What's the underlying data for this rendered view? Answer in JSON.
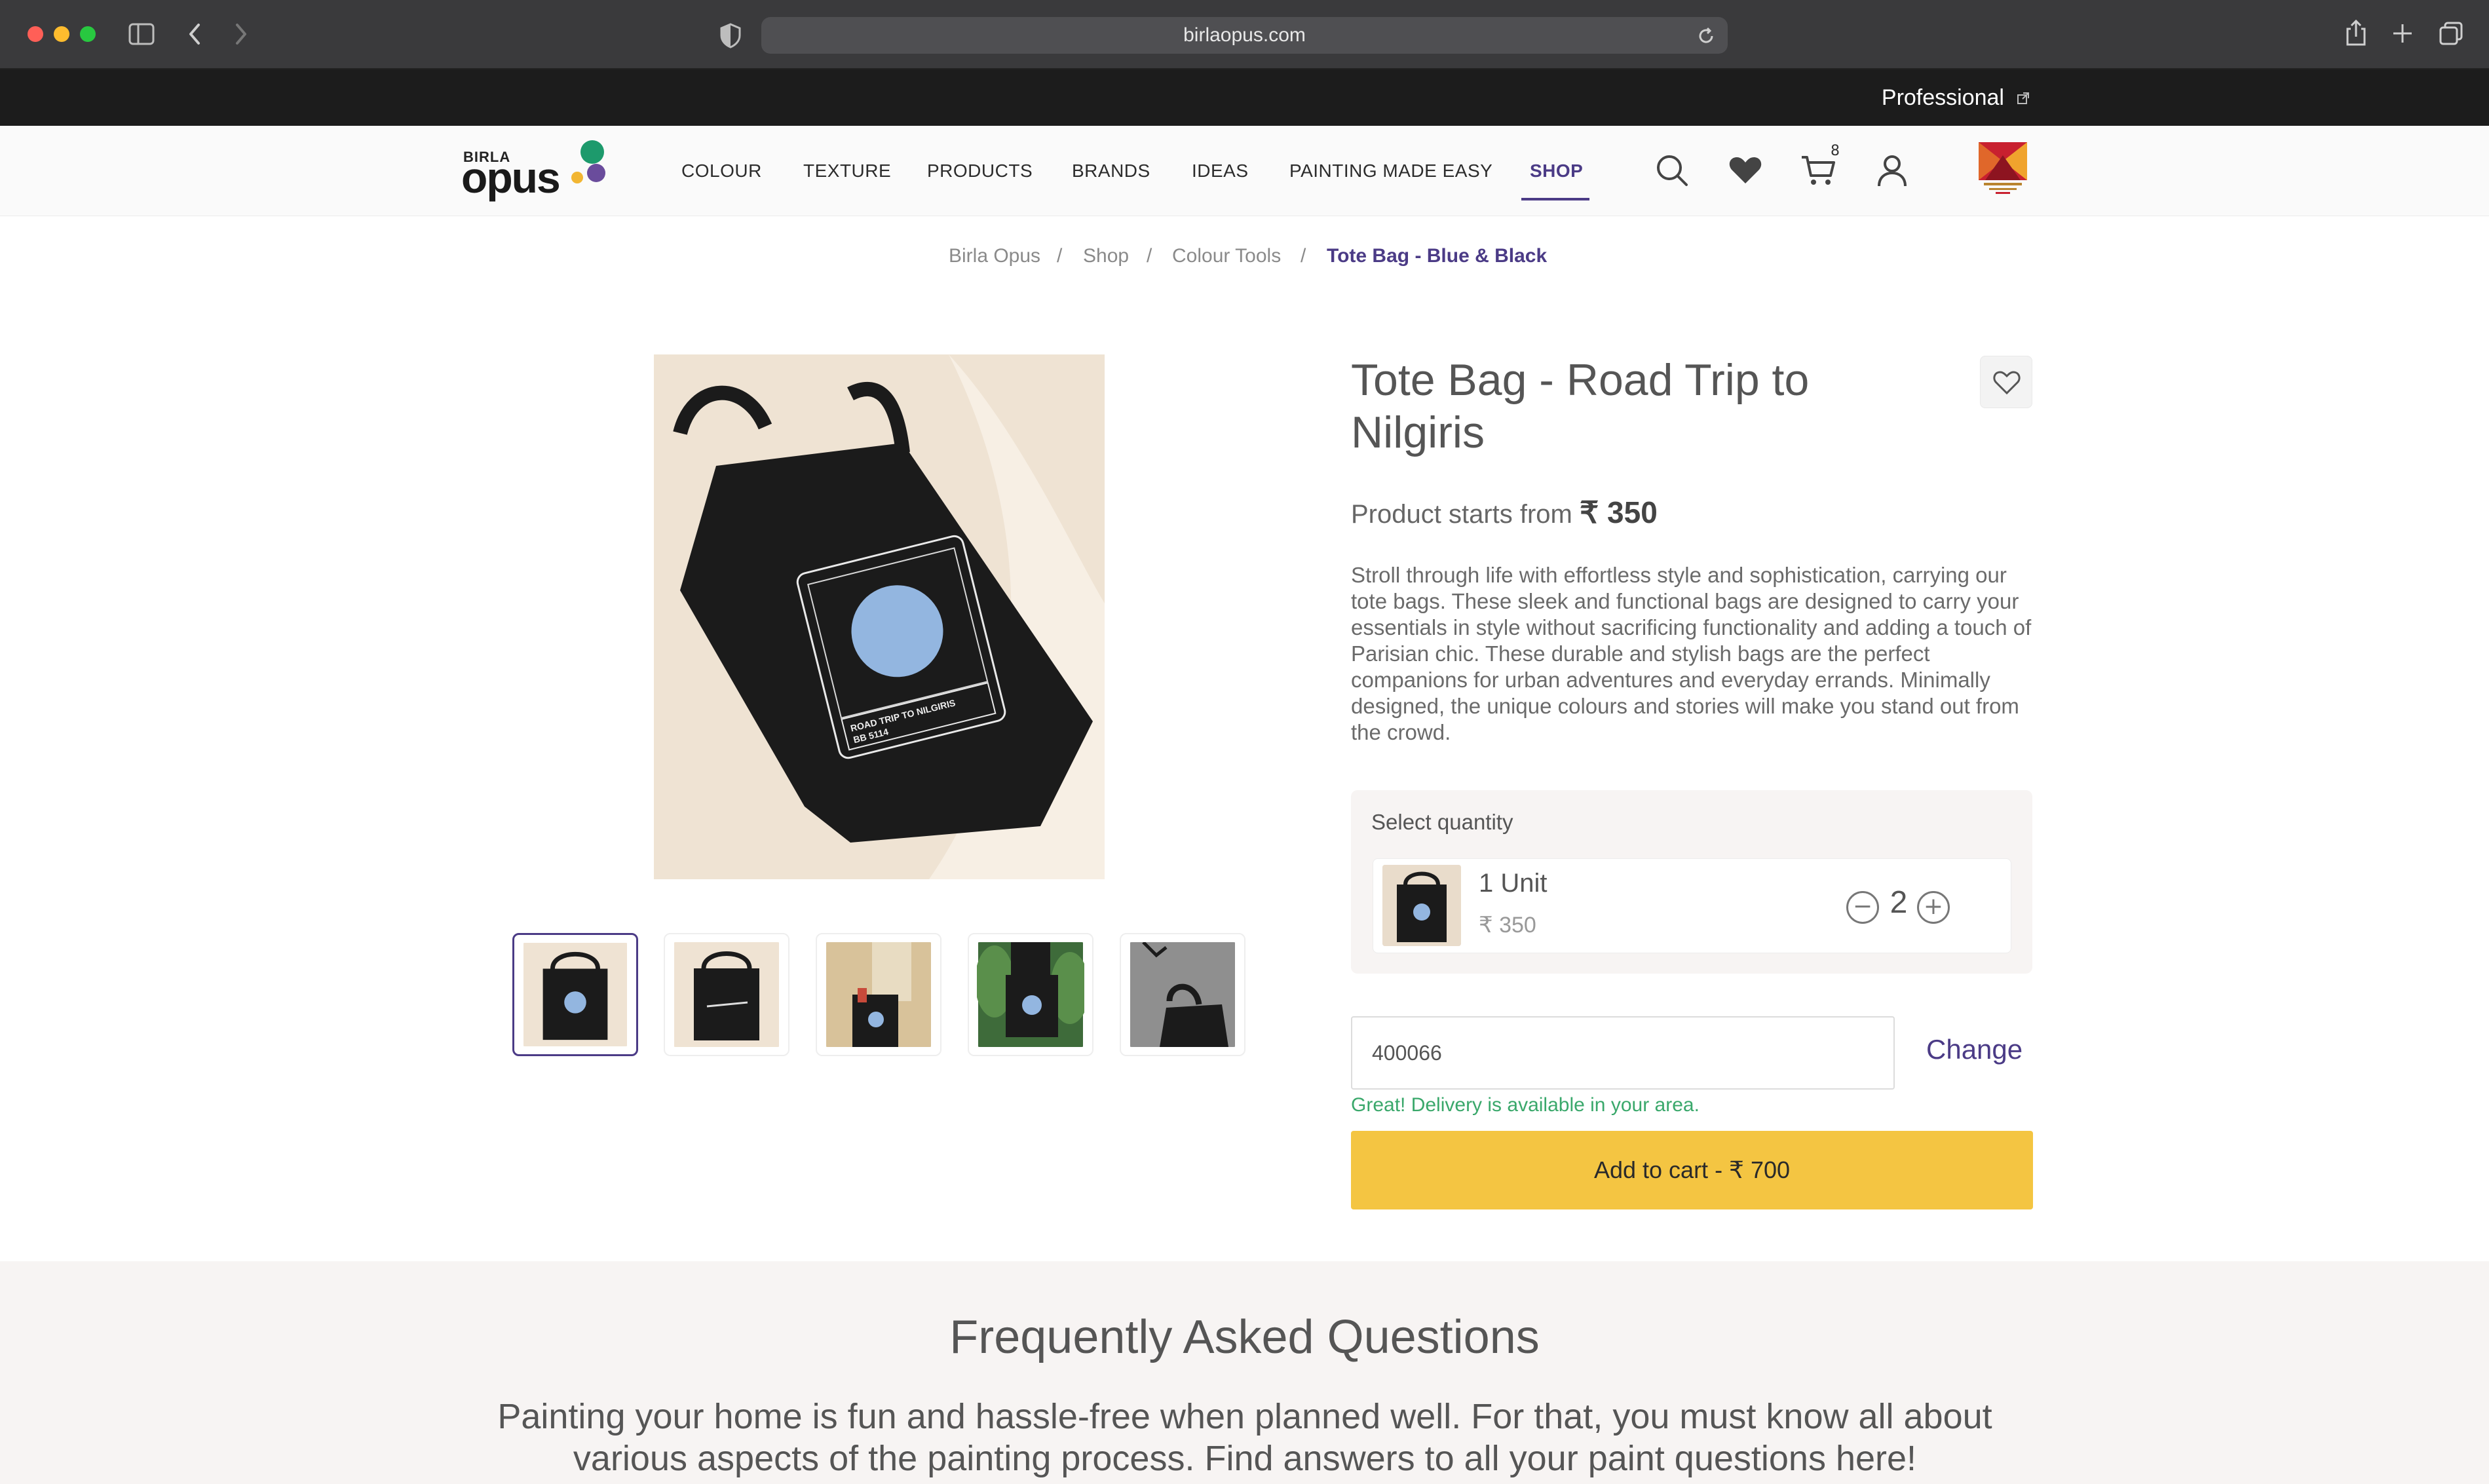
{
  "browser": {
    "url": "birlaopus.com",
    "icons": [
      "close-dot",
      "minimize-dot",
      "zoom-dot",
      "sidebar-icon",
      "back-icon",
      "forward-icon",
      "shield-icon",
      "reload-icon",
      "share-icon",
      "new-tab-icon",
      "tabs-icon"
    ]
  },
  "topbar": {
    "professional_label": "Professional"
  },
  "header": {
    "logo": {
      "small": "BIRLA",
      "big": "opus"
    },
    "nav": [
      "COLOUR",
      "TEXTURE",
      "PRODUCTS",
      "BRANDS",
      "IDEAS",
      "PAINTING MADE EASY",
      "SHOP"
    ],
    "active_nav": "SHOP",
    "cart_count": "8",
    "icons": [
      "search-icon",
      "heart-icon",
      "cart-icon",
      "user-icon",
      "aditya-birla-logo"
    ]
  },
  "breadcrumb": [
    "Birla Opus",
    "Shop",
    "Colour Tools",
    "Tote Bag - Blue & Black"
  ],
  "breadcrumb_separator": "/",
  "product": {
    "title": "Tote Bag - Road Trip to Nilgiris",
    "price_prefix": "Product starts from",
    "price_value": "₹ 350",
    "bag_print_line1": "ROAD TRIP TO NILGIRIS",
    "bag_print_line2": "BB 5114",
    "description": "Stroll through life with effortless style and sophistication, carrying our tote bags. These sleek and functional bags are designed to carry your essentials in style without sacrificing functionality and adding a touch of Parisian chic. These durable and stylish bags are the perfect companions for urban adventures and everyday errands. Minimally designed, the unique colours and stories will make you stand out from the crowd.",
    "thumbnails_count": 5
  },
  "quantity": {
    "label": "Select quantity",
    "unit_name": "1 Unit",
    "unit_price": "₹ 350",
    "value": "2",
    "minus": "−",
    "plus": "+"
  },
  "delivery": {
    "pincode": "400066",
    "change_label": "Change",
    "message": "Great! Delivery is available in your area."
  },
  "cart_button": {
    "label": "Add to cart - ₹ 700"
  },
  "faq": {
    "title": "Frequently Asked Questions",
    "subtitle": "Painting your home is fun and hassle-free when planned well. For that, you must know all about various aspects of the painting process. Find answers to all your paint questions here!"
  },
  "colors": {
    "brand_purple": "#4b3b86",
    "cta_yellow": "#f4c542",
    "success_green": "#3aa86b",
    "bag_black": "#1b1b1b",
    "bag_circle_blue": "#93b6e0"
  }
}
